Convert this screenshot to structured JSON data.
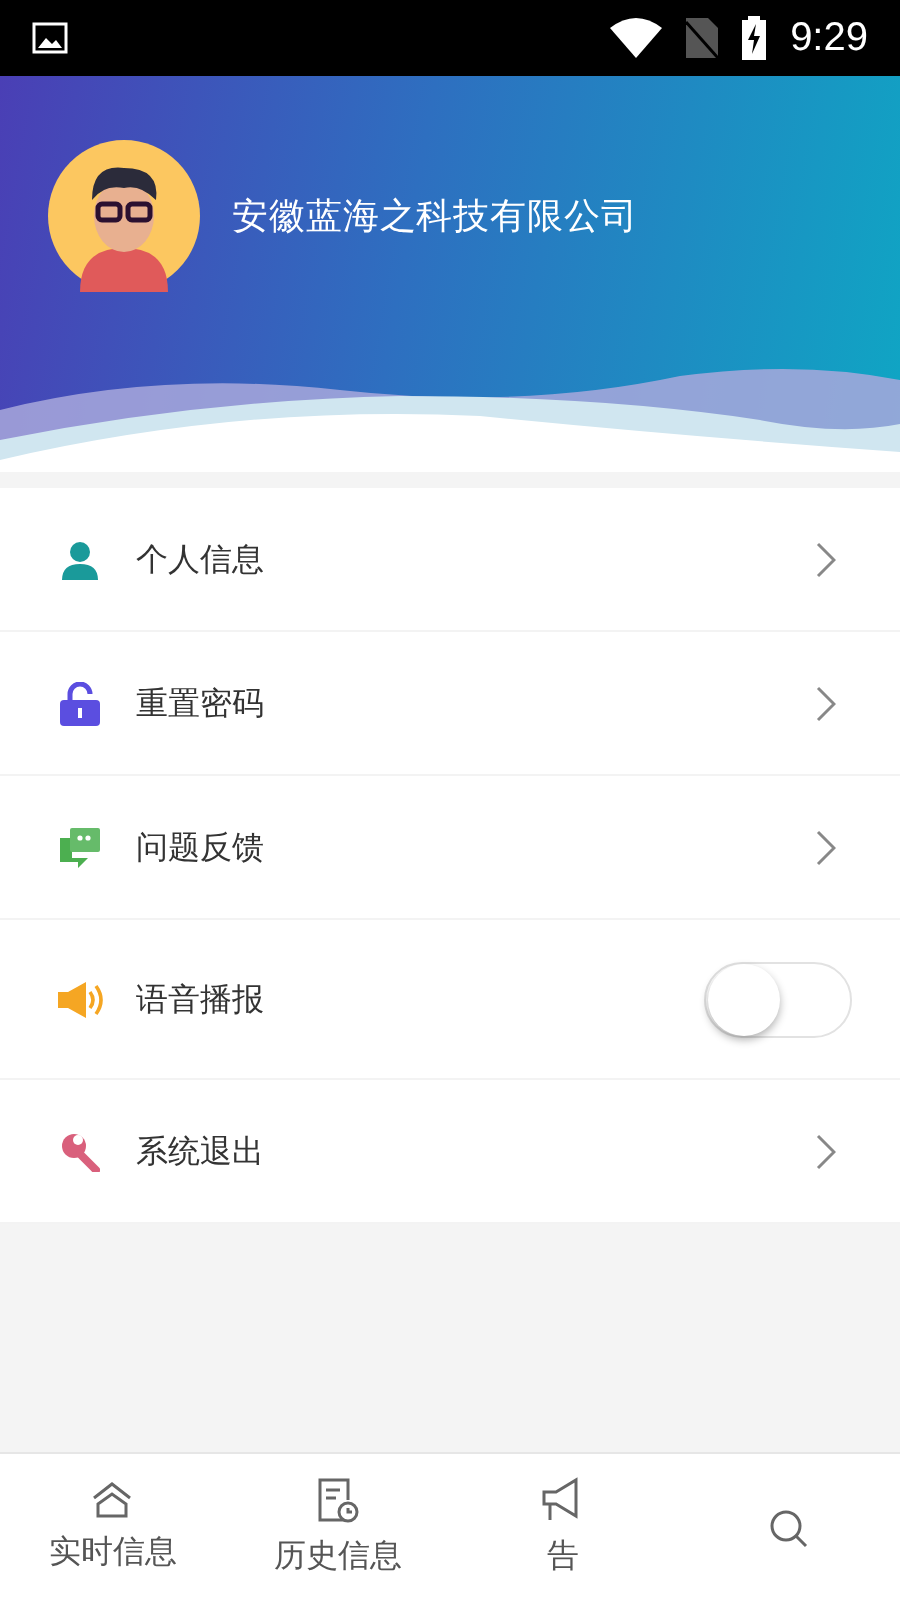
{
  "status_bar": {
    "time": "9:29"
  },
  "profile": {
    "company": "安徽蓝海之科技有限公司"
  },
  "menu": [
    {
      "kind": "link",
      "label": "个人信息"
    },
    {
      "kind": "link",
      "label": "重置密码"
    },
    {
      "kind": "link",
      "label": "问题反馈"
    },
    {
      "kind": "toggle",
      "label": "语音播报",
      "on": false
    },
    {
      "kind": "link",
      "label": "系统退出"
    }
  ],
  "tabs": [
    {
      "kind": "labeled",
      "label": "实时信息"
    },
    {
      "kind": "labeled",
      "label": "历史信息"
    },
    {
      "kind": "labeled",
      "label": "告"
    },
    {
      "kind": "icon_only"
    }
  ]
}
